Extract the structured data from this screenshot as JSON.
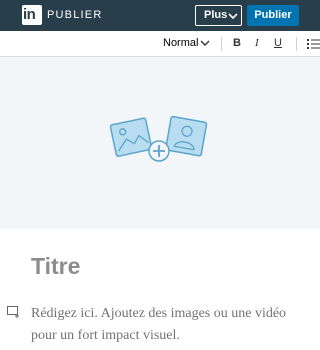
{
  "header": {
    "logo_text": "in",
    "brand_label": "PUBLIER",
    "more_button": "Plus",
    "publish_button": "Publier"
  },
  "toolbar": {
    "text_style": "Normal",
    "bold": "B",
    "italic": "I",
    "underline": "U"
  },
  "editor": {
    "title_placeholder": "Titre",
    "body_placeholder": "Rédigez ici. Ajoutez des images ou une vidéo pour un fort impact visuel."
  },
  "colors": {
    "header_bg": "#283e4a",
    "primary_button": "#0073b1",
    "hero_bg": "#f3f6f8",
    "icon_blue": "#5aa5cc"
  }
}
